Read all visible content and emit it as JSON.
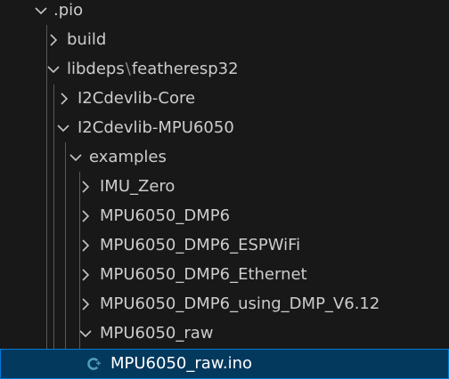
{
  "tree": {
    "pio_folder": ".pio",
    "build_folder": "build",
    "libdeps_path": {
      "part1": "libdeps",
      "separator": "\\",
      "part2": "featheresp32"
    },
    "i2cdevlib_core": "I2Cdevlib-Core",
    "i2cdevlib_mpu6050": "I2Cdevlib-MPU6050",
    "examples_folder": "examples",
    "example_folders": [
      "IMU_Zero",
      "MPU6050_DMP6",
      "MPU6050_DMP6_ESPWiFi",
      "MPU6050_DMP6_Ethernet",
      "MPU6050_DMP6_using_DMP_V6.12",
      "MPU6050_raw"
    ],
    "selected_file": "MPU6050_raw.ino"
  },
  "icons": {
    "expanded": "chevron-down-icon",
    "collapsed": "chevron-right-icon",
    "file": "cpp-file-icon"
  },
  "colors": {
    "background": "#181818",
    "text": "#cccccc",
    "selection_background": "#04395e",
    "selection_border": "#0078d4",
    "file_icon": "#519aba"
  }
}
